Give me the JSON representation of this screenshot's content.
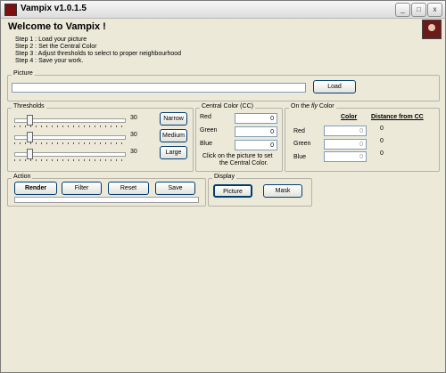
{
  "window": {
    "title": "Vampix v1.0.1.5",
    "minimize": "_",
    "maximize": "□",
    "close": "x"
  },
  "heading": "Welcome to Vampix !",
  "steps": [
    "Step 1 : Load your picture",
    "Step 2 : Set the Central Color",
    "Step 3 : Adjust thresholds to select to proper neighbourhood",
    "Step 4 : Save your work."
  ],
  "picture": {
    "label": "Picture",
    "path_value": "",
    "load_button": "Load"
  },
  "thresholds": {
    "label": "Thresholds",
    "sliders": [
      {
        "value": "30",
        "level": 0.12
      },
      {
        "value": "30",
        "level": 0.12
      },
      {
        "value": "30",
        "level": 0.12
      }
    ],
    "narrow_button": "Narrow",
    "medium_button": "Medium",
    "large_button": "Large"
  },
  "central_color": {
    "label": "Central Color (CC)",
    "red_label": "Red",
    "red_value": "0",
    "green_label": "Green",
    "green_value": "0",
    "blue_label": "Blue",
    "blue_value": "0",
    "hint_line1": "Click on the picture to set",
    "hint_line2": "the Central Color."
  },
  "fly_color": {
    "label_prefix": "On the ",
    "label_italic": "fly",
    "label_suffix": " Color",
    "col_color": "Color",
    "col_distance": "Distance from CC",
    "red_label": "Red",
    "red_value": "0",
    "red_distance": "0",
    "green_label": "Green",
    "green_value": "0",
    "green_distance": "0",
    "blue_label": "Blue",
    "blue_value": "0",
    "blue_distance": "0"
  },
  "action": {
    "label": "Action",
    "render_button": "Render",
    "filter_button": "Filter",
    "reset_button": "Reset",
    "save_button": "Save",
    "progress": 0
  },
  "display": {
    "label": "Display",
    "picture_button": "Picture",
    "mask_button": "Mask"
  }
}
